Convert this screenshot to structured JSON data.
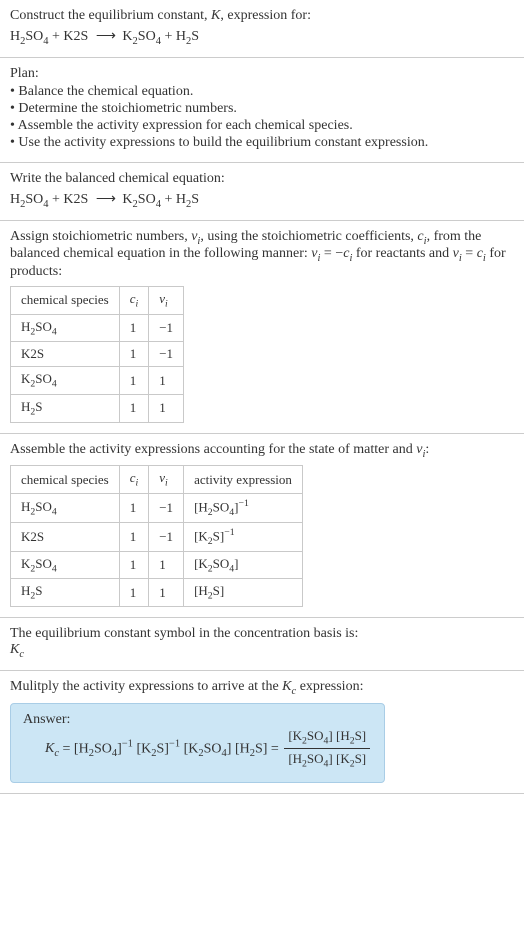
{
  "chart_data": [
    {
      "type": "table",
      "title": "Stoichiometric numbers",
      "columns": [
        "chemical species",
        "cᵢ",
        "νᵢ"
      ],
      "rows": [
        [
          "H₂SO₄",
          1,
          -1
        ],
        [
          "K2S",
          1,
          -1
        ],
        [
          "K₂SO₄",
          1,
          1
        ],
        [
          "H₂S",
          1,
          1
        ]
      ]
    },
    {
      "type": "table",
      "title": "Activity expressions",
      "columns": [
        "chemical species",
        "cᵢ",
        "νᵢ",
        "activity expression"
      ],
      "rows": [
        [
          "H₂SO₄",
          1,
          -1,
          "[H₂SO₄]⁻¹"
        ],
        [
          "K2S",
          1,
          -1,
          "[K₂S]⁻¹"
        ],
        [
          "K₂SO₄",
          1,
          1,
          "[K₂SO₄]"
        ],
        [
          "H₂S",
          1,
          1,
          "[H₂S]"
        ]
      ]
    }
  ],
  "s1": {
    "line1": "Construct the equilibrium constant, K, expression for:",
    "eq_l": "H",
    "eq_2": "2",
    "eq_so": "SO",
    "eq_4": "4",
    "plus": " + ",
    "k2s": "K2S",
    "arrow": "⟶",
    "k": "K",
    "s": "S",
    "h": "H"
  },
  "plan": {
    "head": "Plan:",
    "b1": "• Balance the chemical equation.",
    "b2": "• Determine the stoichiometric numbers.",
    "b3": "• Assemble the activity expression for each chemical species.",
    "b4": "• Use the activity expressions to build the equilibrium constant expression."
  },
  "s3": {
    "head": "Write the balanced chemical equation:"
  },
  "s4": {
    "text1": "Assign stoichiometric numbers, ν",
    "text_i": "i",
    "text2": ", using the stoichiometric coefficients, c",
    "text3": ", from the balanced chemical equation in the following manner: ν",
    "text4": " = −c",
    "text5": " for reactants and ν",
    "text6": " = c",
    "text7": " for products:",
    "h1": "chemical species",
    "h2": "c",
    "h3": "ν",
    "r1c1": "H",
    "r1c2": "1",
    "r1c3": "−1",
    "r2c1": "K2S",
    "r2c2": "1",
    "r2c3": "−1",
    "r3c1": "K",
    "r3c2": "1",
    "r3c3": "1",
    "r4c1": "H",
    "r4c2": "1",
    "r4c3": "1"
  },
  "s5": {
    "head": "Assemble the activity expressions accounting for the state of matter and ν",
    "head2": ":",
    "h1": "chemical species",
    "h2": "c",
    "h3": "ν",
    "h4": "activity expression",
    "r1c2": "1",
    "r1c3": "−1",
    "r2c2": "1",
    "r2c3": "−1",
    "r3c2": "1",
    "r3c3": "1",
    "r4c2": "1",
    "r4c3": "1"
  },
  "s6": {
    "l1": "The equilibrium constant symbol in the concentration basis is:",
    "sym": "K",
    "sub": "c"
  },
  "s7": {
    "head": "Mulitply the activity expressions to arrive at the K",
    "head2": " expression:",
    "ans": "Answer:",
    "kc": "K",
    "c": "c",
    "eq": " = ",
    "part1": "[H",
    "part2": "SO",
    "part3": "]",
    "minus1": "−1",
    "pk2s": " [K",
    "pk2s2": "S]",
    "pk2so4": " [K",
    "pk2so4b": "SO",
    "pk2so4c": "] ",
    "ph2s": "[H",
    "ph2s2": "S] = ",
    "num1": "[K",
    "num2": "SO",
    "num3": "] [H",
    "num4": "S]",
    "den1": "[H",
    "den2": "SO",
    "den3": "] [K",
    "den4": "S]"
  },
  "sub2": "2",
  "sub4": "4",
  "subi": "i"
}
